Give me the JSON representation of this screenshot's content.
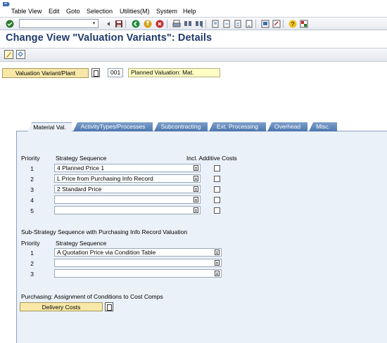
{
  "menu": {
    "items": [
      "Table View",
      "Edit",
      "Goto",
      "Selection",
      "Utilities(M)",
      "System",
      "Help"
    ]
  },
  "toolbar": {
    "icons": [
      "enter-icon",
      "back-icon",
      "exit-icon",
      "cancel-icon",
      "print-icon",
      "find-icon",
      "find-next-icon",
      "first-page-icon",
      "prev-page-icon",
      "next-page-icon",
      "last-page-icon",
      "new-session-icon",
      "shortcut-icon",
      "help-icon",
      "layout-icon"
    ]
  },
  "title": "Change View \"Valuation Variants\": Details",
  "header": {
    "valuation_variant_label": "Valuation Variant/Plant",
    "variant_value": "001",
    "variant_description": "Planned Valuation: Mat."
  },
  "tabs": [
    "Material Val.",
    "ActivityTypes/Processes",
    "Subcontracting",
    "Ext. Processing",
    "Overhead",
    "Misc."
  ],
  "strategy": {
    "col_priority": "Priority",
    "col_sequence": "Strategy Sequence",
    "col_additive": "Incl. Additive Costs",
    "rows": [
      {
        "num": "1",
        "value": "4 Planned Price 1"
      },
      {
        "num": "2",
        "value": "L Price from Purchasing Info Record"
      },
      {
        "num": "3",
        "value": "2 Standard Price"
      },
      {
        "num": "4",
        "value": ""
      },
      {
        "num": "5",
        "value": ""
      }
    ]
  },
  "sub_strategy": {
    "title": "Sub-Strategy Sequence with Purchasing Info Record Valuation",
    "col_priority": "Priority",
    "col_sequence": "Strategy Sequence",
    "rows": [
      {
        "num": "1",
        "value": "A Quotation Price via Condition Table"
      },
      {
        "num": "2",
        "value": ""
      },
      {
        "num": "3",
        "value": ""
      }
    ]
  },
  "purchasing": {
    "title": "Purchasing: Assignment of Conditions to Cost Comps",
    "button": "Delivery Costs"
  },
  "colors": {
    "title": "#1f3a6b",
    "tab": "#5a80b4",
    "label_button": "#f7e8a8",
    "panel": "#ebf1f8"
  }
}
